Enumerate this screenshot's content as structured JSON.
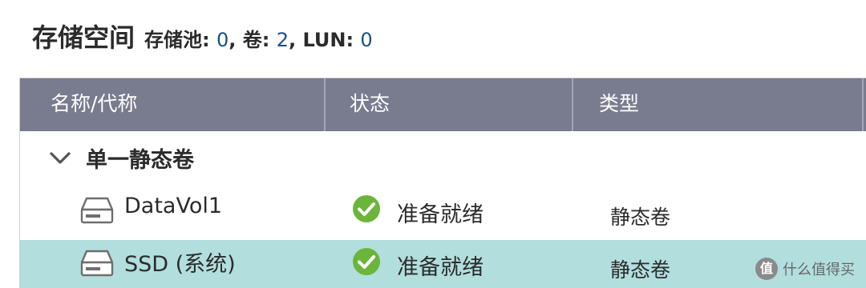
{
  "header": {
    "title": "存储空间",
    "summary_prefix_pool": "存储池: ",
    "pool_count": "0",
    "summary_sep_vol": ", 卷: ",
    "volume_count": "2",
    "summary_sep_lun": ", LUN: ",
    "lun_count": "0"
  },
  "table": {
    "columns": [
      "名称/代称",
      "状态",
      "类型"
    ],
    "group": {
      "label": "单一静态卷",
      "icon": "chevron-down-icon"
    },
    "rows": [
      {
        "name": "DataVol1",
        "status": "准备就绪",
        "type": "静态卷",
        "icon": "disk-icon",
        "status_icon": "check-circle-icon"
      },
      {
        "name": "SSD (系统)",
        "status": "准备就绪",
        "type": "静态卷",
        "icon": "disk-icon",
        "status_icon": "check-circle-icon"
      }
    ]
  },
  "watermark": {
    "icon_text": "值",
    "text": "什么值得买"
  },
  "colors": {
    "header_bg": "#797b8e",
    "selected_row_bg": "#b2dede",
    "count_blue": "#1a4f8c",
    "ready_green": "#6bb53a"
  }
}
